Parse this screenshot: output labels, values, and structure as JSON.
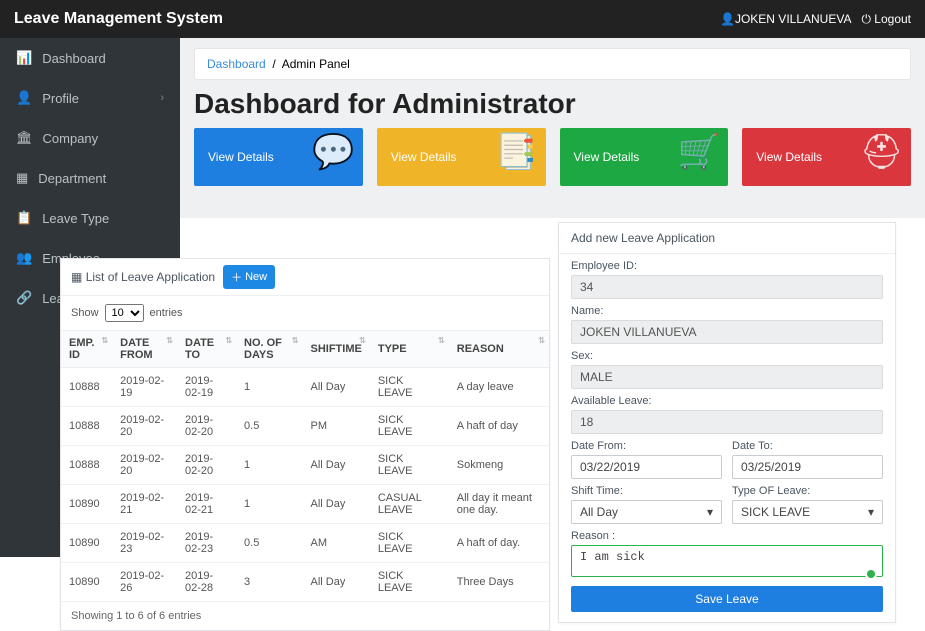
{
  "app_title": "Leave Management System",
  "user": {
    "name": "JOKEN VILLANUEVA",
    "logout_label": "Logout"
  },
  "sidebar": {
    "items": [
      {
        "label": "Dashboard"
      },
      {
        "label": "Profile",
        "has_sub": true
      },
      {
        "label": "Company"
      },
      {
        "label": "Department"
      },
      {
        "label": "Leave Type"
      },
      {
        "label": "Employee"
      },
      {
        "label": "Leav"
      }
    ]
  },
  "breadcrumb": {
    "link": "Dashboard",
    "current": "Admin Panel"
  },
  "page_title": "Dashboard for Administrator",
  "cards": [
    {
      "label": "View Details"
    },
    {
      "label": "View Details"
    },
    {
      "label": "View Details"
    },
    {
      "label": "View Details"
    }
  ],
  "list_panel": {
    "title": "List of Leave Application",
    "new_btn": "New",
    "show_label_pre": "Show",
    "show_value": "10",
    "show_label_post": "entries",
    "columns": [
      "EMP. ID",
      "DATE FROM",
      "DATE TO",
      "NO. OF DAYS",
      "SHIFTIME",
      "TYPE",
      "REASON"
    ],
    "rows": [
      [
        "10888",
        "2019-02-19",
        "2019-02-19",
        "1",
        "All Day",
        "SICK LEAVE",
        "A day leave"
      ],
      [
        "10888",
        "2019-02-20",
        "2019-02-20",
        "0.5",
        "PM",
        "SICK LEAVE",
        "A haft of day"
      ],
      [
        "10888",
        "2019-02-20",
        "2019-02-20",
        "1",
        "All Day",
        "SICK LEAVE",
        "Sokmeng"
      ],
      [
        "10890",
        "2019-02-21",
        "2019-02-21",
        "1",
        "All Day",
        "CASUAL LEAVE",
        "All day it meant one day."
      ],
      [
        "10890",
        "2019-02-23",
        "2019-02-23",
        "0.5",
        "AM",
        "SICK LEAVE",
        "A haft of day."
      ],
      [
        "10890",
        "2019-02-26",
        "2019-02-28",
        "3",
        "All Day",
        "SICK LEAVE",
        "Three Days"
      ]
    ],
    "info": "Showing 1 to 6 of 6 entries"
  },
  "form_panel": {
    "title": "Add new Leave Application",
    "employee_id_label": "Employee ID:",
    "employee_id": "34",
    "name_label": "Name:",
    "name": "JOKEN VILLANUEVA",
    "sex_label": "Sex:",
    "sex": "MALE",
    "available_label": "Available Leave:",
    "available": "18",
    "date_from_label": "Date From:",
    "date_from": "03/22/2019",
    "date_to_label": "Date To:",
    "date_to": "03/25/2019",
    "shift_label": "Shift Time:",
    "shift": "All Day",
    "type_label": "Type OF Leave:",
    "type": "SICK LEAVE",
    "reason_label": "Reason :",
    "reason": "I am sick",
    "save_label": "Save Leave"
  }
}
